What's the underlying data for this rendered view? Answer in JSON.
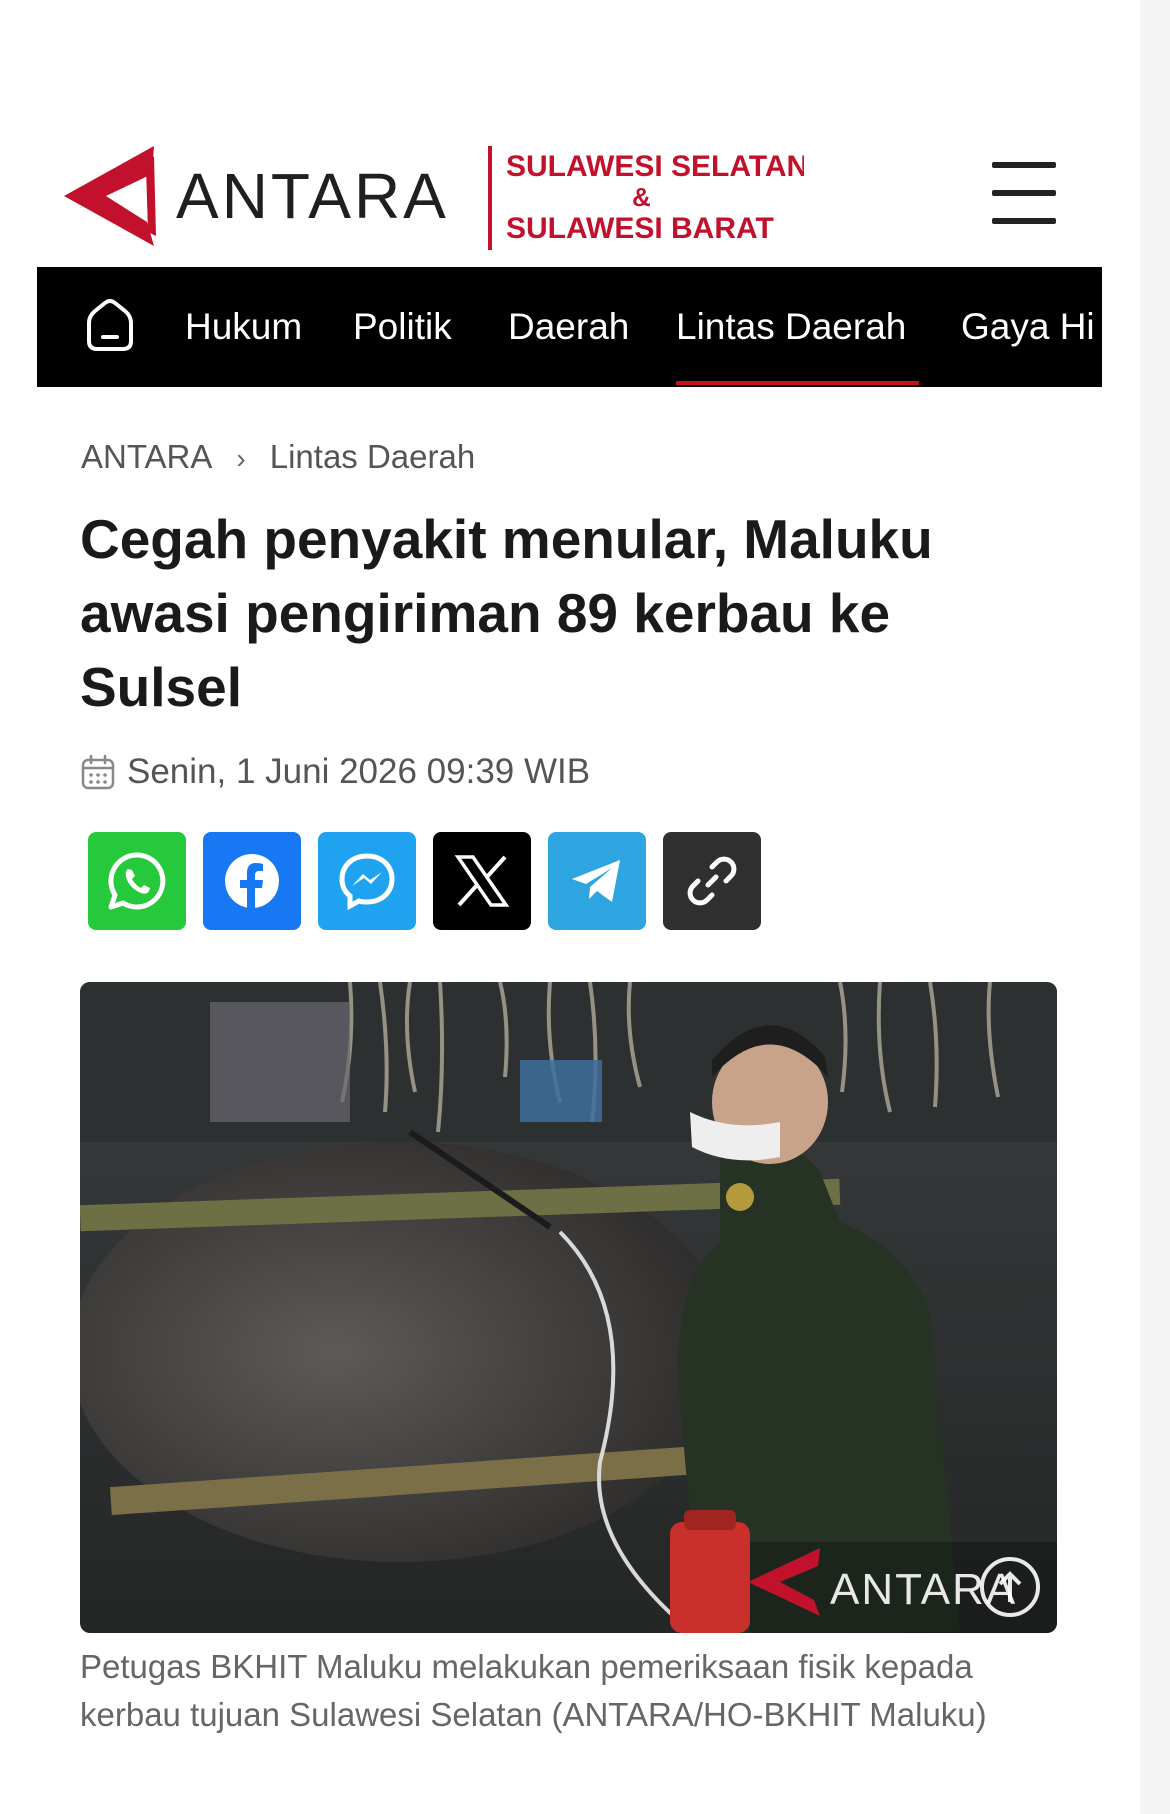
{
  "header": {
    "logo_name": "ANTARA",
    "region_line1": "SULAWESI SELATAN",
    "region_amp": "&",
    "region_line2": "SULAWESI BARAT",
    "menu_icon": "hamburger-menu-icon"
  },
  "nav": {
    "home_icon": "home-icon",
    "items": [
      "Hukum",
      "Politik",
      "Daerah",
      "Lintas Daerah",
      "Gaya Hi"
    ],
    "active": "Lintas Daerah",
    "accent": "#c4121c"
  },
  "breadcrumb": {
    "root": "ANTARA",
    "separator": "›",
    "current": "Lintas Daerah"
  },
  "article": {
    "title": "Cegah penyakit menular, Maluku awasi pengiriman 89 kerbau ke Sulsel",
    "date": "Senin, 1 Juni 2026 09:39 WIB",
    "date_icon": "calendar-icon"
  },
  "share": [
    {
      "name": "whatsapp",
      "icon": "whatsapp-icon",
      "color": "#25c93b"
    },
    {
      "name": "facebook",
      "icon": "facebook-icon",
      "color": "#1877f2"
    },
    {
      "name": "messenger",
      "icon": "messenger-icon",
      "color": "#1fa3f0"
    },
    {
      "name": "x",
      "icon": "x-icon",
      "color": "#000000"
    },
    {
      "name": "telegram",
      "icon": "telegram-icon",
      "color": "#2ea5e0"
    },
    {
      "name": "copy-link",
      "icon": "link-icon",
      "color": "#2f2f2f"
    }
  ],
  "photo": {
    "watermark": "ANTARA",
    "caption": "Petugas BKHIT Maluku melakukan pemeriksaan fisik kepada kerbau tujuan Sulawesi Selatan (ANTARA/HO-BKHIT Maluku)"
  }
}
